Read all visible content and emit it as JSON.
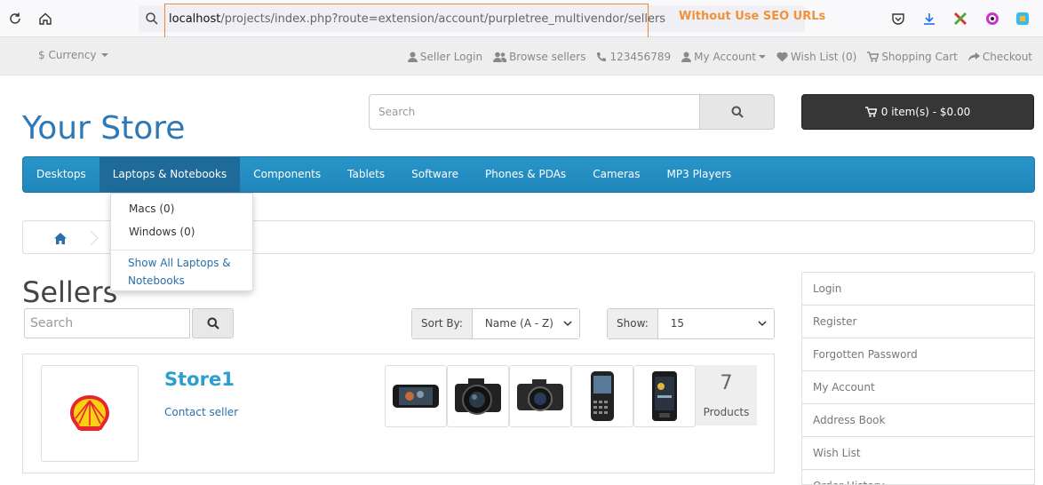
{
  "browser": {
    "url_host": "localhost",
    "url_path": "/projects/index.php?route=extension/account/purpletree_multivendor/sellers",
    "seo_note": "Without Use SEO URLs"
  },
  "topbar": {
    "currency": "$ Currency",
    "links": [
      "Seller Login",
      "Browse sellers",
      "123456789",
      "My Account",
      "Wish List (0)",
      "Shopping Cart",
      "Checkout"
    ]
  },
  "header": {
    "logo": "Your Store",
    "search_placeholder": "Search",
    "cart_label": "0 item(s) - $0.00"
  },
  "menu": {
    "items": [
      "Desktops",
      "Laptops & Notebooks",
      "Components",
      "Tablets",
      "Software",
      "Phones & PDAs",
      "Cameras",
      "MP3 Players"
    ]
  },
  "dropdown": {
    "items": [
      "Macs (0)",
      "Windows (0)"
    ],
    "show_all": "Show All Laptops & Notebooks"
  },
  "page": {
    "title": "Sellers",
    "search_placeholder": "Search",
    "sort_label": "Sort By:",
    "sort_value": "Name (A - Z)",
    "show_label": "Show:",
    "show_value": "15"
  },
  "seller": {
    "name": "Store1",
    "contact": "Contact seller",
    "product_count": "7",
    "product_label": "Products"
  },
  "sidebar": {
    "items": [
      "Login",
      "Register",
      "Forgotten Password",
      "My Account",
      "Address Book",
      "Wish List",
      "Order History"
    ]
  },
  "colors": {
    "accent": "#2e78b5",
    "menu": "#2492c6",
    "seo_note": "#f0923a"
  }
}
